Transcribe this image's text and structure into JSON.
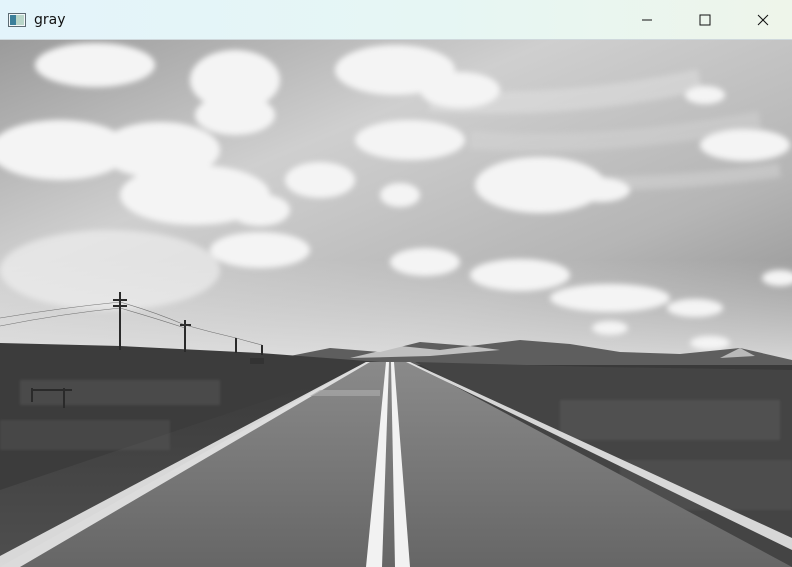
{
  "window": {
    "title": "gray",
    "controls": {
      "minimize": "minimize-icon",
      "maximize": "maximize-icon",
      "close": "close-icon"
    }
  },
  "image": {
    "mode": "grayscale",
    "scene": "photo"
  },
  "colors": {
    "titlebar_start": "#e3f4fb",
    "titlebar_end": "#eef5ea",
    "title_text": "#111111"
  }
}
